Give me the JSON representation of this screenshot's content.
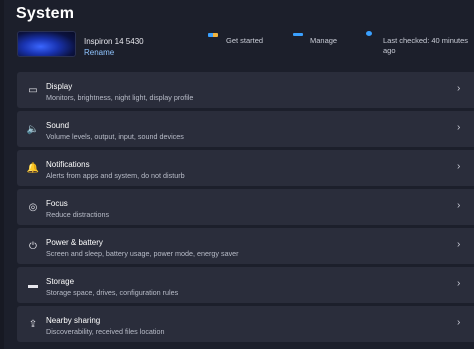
{
  "window": {
    "title": "System"
  },
  "device": {
    "name": "Inspiron 14 5430",
    "rename_label": "Rename"
  },
  "quick_actions": [
    {
      "label": "Get started",
      "icon": "windows-color-icon",
      "color": "#f2b33d"
    },
    {
      "label": "Manage",
      "icon": "cloud-icon",
      "color": "#3aa0ff"
    },
    {
      "label": "Last checked: 40 minutes ago",
      "icon": "update-icon",
      "color": "#3aa0ff"
    }
  ],
  "settings": [
    {
      "icon": "display-icon",
      "glyph": "▭",
      "title": "Display",
      "subtitle": "Monitors, brightness, night light, display profile"
    },
    {
      "icon": "sound-icon",
      "glyph": "🔈",
      "title": "Sound",
      "subtitle": "Volume levels, output, input, sound devices"
    },
    {
      "icon": "bell-icon",
      "glyph": "🔔",
      "title": "Notifications",
      "subtitle": "Alerts from apps and system, do not disturb"
    },
    {
      "icon": "focus-icon",
      "glyph": "◎",
      "title": "Focus",
      "subtitle": "Reduce distractions"
    },
    {
      "icon": "power-icon",
      "glyph": "⏻",
      "title": "Power & battery",
      "subtitle": "Screen and sleep, battery usage, power mode, energy saver"
    },
    {
      "icon": "storage-icon",
      "glyph": "▬",
      "title": "Storage",
      "subtitle": "Storage space, drives, configuration rules"
    },
    {
      "icon": "share-icon",
      "glyph": "⇪",
      "title": "Nearby sharing",
      "subtitle": "Discoverability, received files location"
    }
  ],
  "chevron_glyph": "›"
}
